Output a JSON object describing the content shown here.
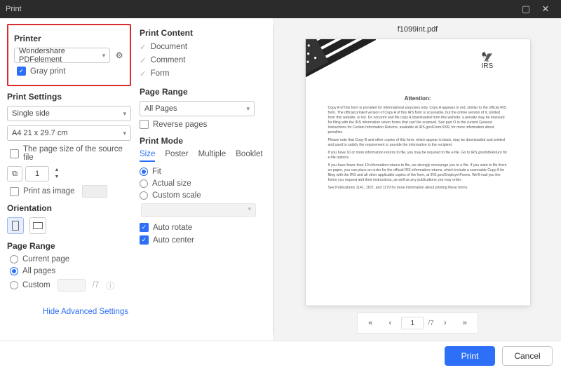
{
  "window": {
    "title": "Print"
  },
  "printer": {
    "heading": "Printer",
    "selected": "Wondershare PDFelement",
    "gray_print_label": "Gray print",
    "gray_print_checked": true
  },
  "print_settings": {
    "heading": "Print Settings",
    "sides_selected": "Single side",
    "paper_selected": "A4 21 x 29.7 cm",
    "page_size_source_label": "The page size of the source file",
    "page_size_source_checked": false,
    "copies_value": "1",
    "print_as_image_label": "Print as image",
    "print_as_image_checked": false
  },
  "orientation": {
    "heading": "Orientation",
    "portrait_active": true,
    "landscape_active": false
  },
  "page_range_left": {
    "heading": "Page Range",
    "current_label": "Current page",
    "all_label": "All pages",
    "custom_label": "Custom",
    "selected": "all",
    "custom_total": "/7"
  },
  "print_content": {
    "heading": "Print Content",
    "document_label": "Document",
    "document_checked": true,
    "comment_label": "Comment",
    "comment_checked": true,
    "form_label": "Form",
    "form_checked": true
  },
  "page_range_mid": {
    "heading": "Page Range",
    "selected": "All Pages",
    "reverse_label": "Reverse pages",
    "reverse_checked": false
  },
  "print_mode": {
    "heading": "Print Mode",
    "tabs": {
      "size": "Size",
      "poster": "Poster",
      "multiple": "Multiple",
      "booklet": "Booklet"
    },
    "active_tab": "size",
    "fit_label": "Fit",
    "actual_label": "Actual size",
    "custom_scale_label": "Custom scale",
    "radio_selected": "fit",
    "auto_rotate_label": "Auto rotate",
    "auto_rotate_checked": true,
    "auto_center_label": "Auto center",
    "auto_center_checked": true
  },
  "advanced_link": "Hide Advanced Settings",
  "preview": {
    "filename": "f1099int.pdf",
    "logo_text": "IRS",
    "attention": "Attention:",
    "page_current": "1",
    "page_total": "/7"
  },
  "footer": {
    "print_label": "Print",
    "cancel_label": "Cancel"
  }
}
